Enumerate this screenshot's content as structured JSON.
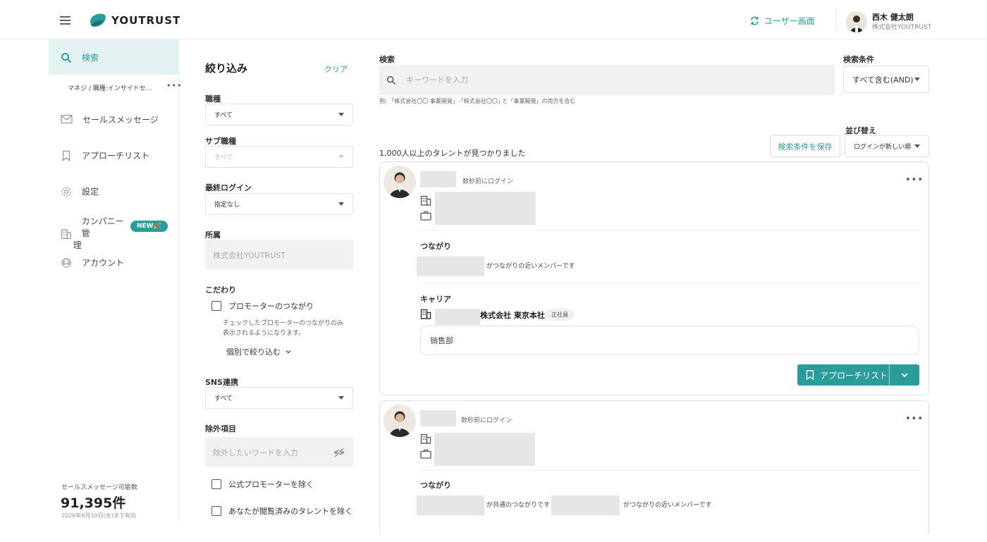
{
  "header": {
    "brand": "YOUTRUST",
    "user_switch": "ユーザー画面",
    "user": {
      "name": "西木 健太朗",
      "company": "株式会社YOUTRUST"
    }
  },
  "sidebar": {
    "search": "検索",
    "saved_search": "マネジ / 職種:インサイドセールス",
    "saved_more": "•••",
    "sales_message": "セールスメッセージ",
    "approach_list": "アプローチリスト",
    "settings": "設定",
    "company_admin_line1": "カンパニー管",
    "company_admin_line2": "理",
    "new_badge": "NEW🎉",
    "account": "アカウント",
    "message_quota_label": "セールスメッセージ可能数",
    "message_quota": "91,395件",
    "message_valid_until": "2026年6月10日(水)まで有効"
  },
  "filters": {
    "title": "絞り込み",
    "clear": "クリア",
    "job_type": {
      "label": "職種",
      "value": "すべて"
    },
    "sub_job_type": {
      "label": "サブ職種",
      "value": "すべて"
    },
    "last_login": {
      "label": "最終ログイン",
      "value": "指定なし"
    },
    "affiliation": {
      "label": "所属",
      "placeholder": "株式会社YOUTRUST"
    },
    "preferences": {
      "label": "こだわり",
      "promoter_connection": "プロモーターのつながり",
      "hint": "チェックしたプロモーターのつながりのみ表示されるようになります。",
      "individual": "個別で絞り込む"
    },
    "sns": {
      "label": "SNS連携",
      "value": "すべて"
    },
    "exclude": {
      "label": "除外項目",
      "placeholder": "除外したいワードを入力",
      "official_promoter": "公式プロモーターを除く",
      "viewed": "あなたが閲覧済みのタレントを除く"
    }
  },
  "main": {
    "search_label": "検索",
    "search_placeholder": "キーワードを入力",
    "search_example": "例: 「株式会社〇〇 事業開発」･｢株式会社〇〇｣ と「事業開発」の両方を含む",
    "condition_label": "検索条件",
    "condition_value": "すべて含む(AND)",
    "sort_label": "並び替え",
    "sort_value": "ログインが新しい順",
    "save_conditions": "検索条件を保存",
    "result_count": "1,000人以上のタレントが見つかりました"
  },
  "cards": [
    {
      "login": "数秒前にログイン",
      "more": "•••",
      "connection_label": "つながり",
      "connection_text": "がつながりの近いメンバーです",
      "career_label": "キャリア",
      "company": "株式会社 東京本社",
      "employment": "正社員",
      "department": "销售部",
      "approach_button": "アプローチリスト"
    },
    {
      "login": "数秒前にログイン",
      "more": "•••",
      "connection_label": "つながり",
      "connection_text_1": "が共通のつながりです",
      "connection_text_2": "がつながりの近いメンバーです"
    }
  ],
  "icons": {
    "menu": "hamburger-icon",
    "search": "search-icon",
    "mail": "mail-icon",
    "bookmark": "bookmark-icon",
    "settings": "gear-icon",
    "building": "building-icon",
    "account": "account-icon",
    "briefcase": "briefcase-icon",
    "visibility_off": "eye-off-icon",
    "refresh": "refresh-icon"
  },
  "colors": {
    "accent": "#2a9d9a",
    "active_bg": "#e3f3f2",
    "placeholder_bg": "#e6e6e6"
  }
}
